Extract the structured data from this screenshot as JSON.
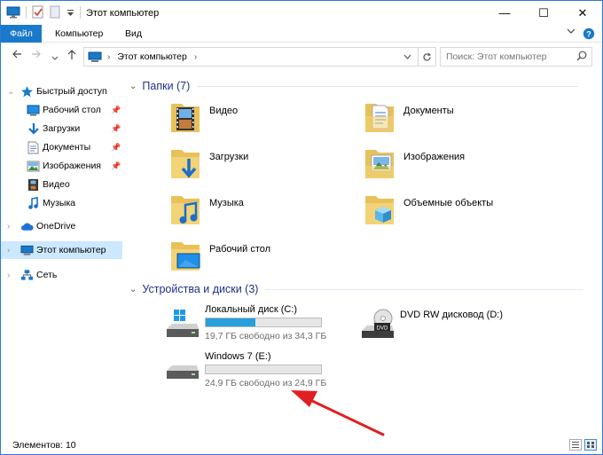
{
  "window": {
    "title": "Этот компьютер",
    "minimize_glyph": "—",
    "maximize_glyph": "☐",
    "close_glyph": "✕"
  },
  "ribbon": {
    "tabs": [
      "Файл",
      "Компьютер",
      "Вид"
    ],
    "help_glyph": "?"
  },
  "address": {
    "path": [
      "Этот компьютер"
    ],
    "search_placeholder": "Поиск: Этот компьютер"
  },
  "nav": {
    "items": [
      {
        "label": "Быстрый доступ",
        "icon": "star-icon"
      },
      {
        "label": "Рабочий стол",
        "icon": "desktop-icon",
        "pinned": true
      },
      {
        "label": "Загрузки",
        "icon": "download-icon",
        "pinned": true
      },
      {
        "label": "Документы",
        "icon": "document-icon",
        "pinned": true
      },
      {
        "label": "Изображения",
        "icon": "pictures-icon",
        "pinned": true
      },
      {
        "label": "Видео",
        "icon": "video-icon"
      },
      {
        "label": "Музыка",
        "icon": "music-icon"
      },
      {
        "label": "OneDrive",
        "icon": "cloud-icon"
      },
      {
        "label": "Этот компьютер",
        "icon": "computer-icon",
        "selected": true
      },
      {
        "label": "Сеть",
        "icon": "network-icon"
      }
    ]
  },
  "folders_group": {
    "title": "Папки (7)",
    "items": [
      {
        "name": "Видео",
        "icon": "video-folder-icon"
      },
      {
        "name": "Документы",
        "icon": "documents-folder-icon"
      },
      {
        "name": "Загрузки",
        "icon": "downloads-folder-icon"
      },
      {
        "name": "Изображения",
        "icon": "pictures-folder-icon"
      },
      {
        "name": "Музыка",
        "icon": "music-folder-icon"
      },
      {
        "name": "Объемные объекты",
        "icon": "3d-objects-folder-icon"
      },
      {
        "name": "Рабочий стол",
        "icon": "desktop-folder-icon"
      }
    ]
  },
  "drives_group": {
    "title": "Устройства и диски (3)",
    "items": [
      {
        "name": "Локальный диск (C:)",
        "free": "19,7 ГБ свободно из 34,3 ГБ",
        "used_fraction": 0.43,
        "icon": "windows-drive-icon"
      },
      {
        "name": "DVD RW дисковод (D:)",
        "icon": "dvd-drive-icon"
      },
      {
        "name": "Windows 7  (E:)",
        "free": "24,9 ГБ свободно из 24,9 ГБ",
        "used_fraction": 0.0,
        "icon": "hard-drive-icon"
      }
    ]
  },
  "status": {
    "count": "Элементов: 10"
  },
  "colors": {
    "accent": "#1979ca",
    "selection": "#cce8ff",
    "bar_fill": "#26a0da",
    "group_title": "#1e3287",
    "annotation_arrow": "#e02020"
  }
}
